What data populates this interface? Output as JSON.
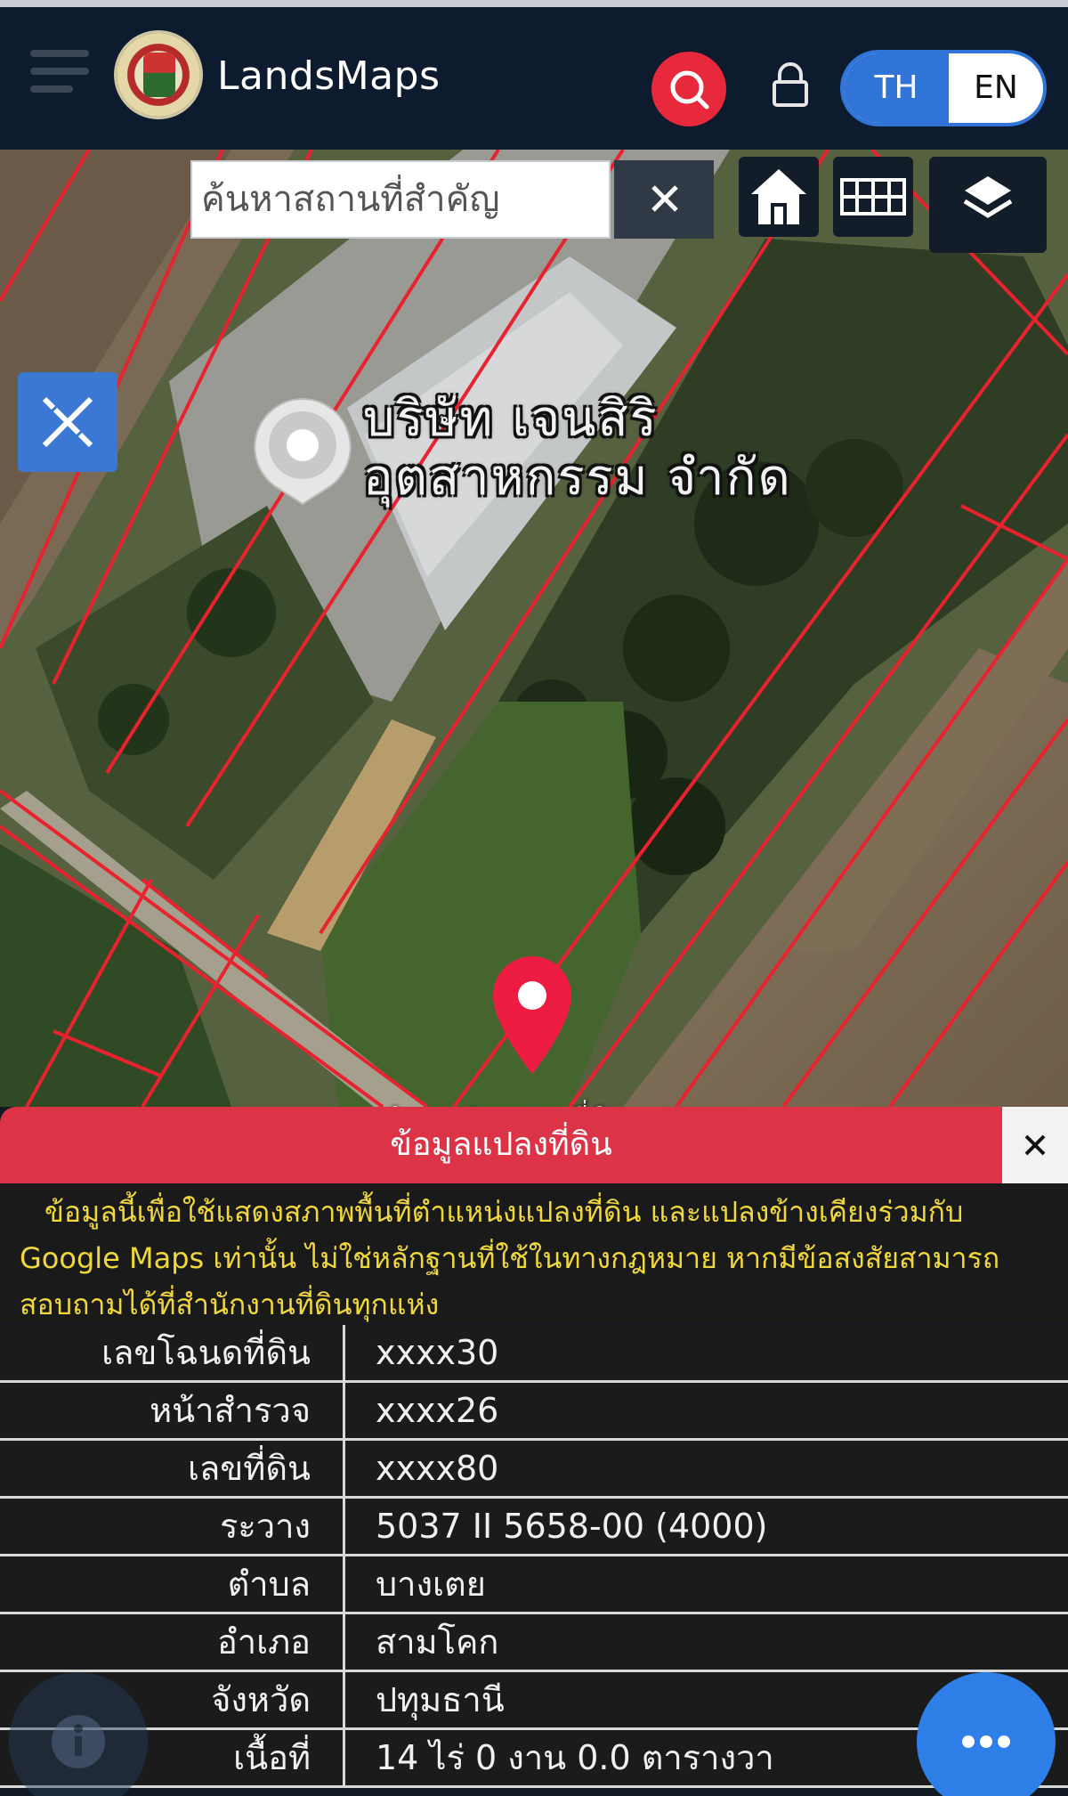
{
  "header": {
    "app_title": "LandsMaps",
    "menu_icon": "hamburger-menu-icon",
    "search_icon": "search-icon",
    "lock_icon": "lock-icon",
    "lang_th": "TH",
    "lang_en": "EN",
    "lang_selected": "TH",
    "colors": {
      "background": "#0d1b2e",
      "search_button": "#e8283b",
      "lang_active": "#2f74d6"
    }
  },
  "map": {
    "search_placeholder": "ค้นหาสถานที่สำคัญ",
    "clear_icon": "close-icon",
    "buttons": [
      "home-icon",
      "grid-icon",
      "layers-icon",
      "measure-tool-icon"
    ],
    "company_label_line1": "บริษัท เจนสิริ",
    "company_label_line2": "อุตสาหกรรม จำกัด",
    "parcel_label": "ตำแหน่งแปลงที่ดิน",
    "parcel_line_color": "#e8222e"
  },
  "panel": {
    "title": "ข้อมูลแปลงที่ดิน",
    "close_icon": "close-icon",
    "notice_line1": "ข้อมูลนี้เพื่อใช้แสดงสภาพพื้นที่ตำแหน่งแปลงที่ดิน และแปลงข้างเคียงร่วมกับ",
    "notice_line2": "Google Maps เท่านั้น ไม่ใช่หลักฐานที่ใช้ในทางกฎหมาย หากมีข้อสงสัยสามารถ",
    "notice_line3": "สอบถามได้ที่สำนักงานที่ดินทุกแห่ง",
    "rows": [
      {
        "label": "เลขโฉนดที่ดิน",
        "value": "xxxx30"
      },
      {
        "label": "หน้าสำรวจ",
        "value": "xxxx26"
      },
      {
        "label": "เลขที่ดิน",
        "value": "xxxx80"
      },
      {
        "label": "ระวาง",
        "value": "5037 II 5658-00 (4000)"
      },
      {
        "label": "ตำบล",
        "value": "บางเตย"
      },
      {
        "label": "อำเภอ",
        "value": "สามโคก"
      },
      {
        "label": "จังหวัด",
        "value": "ปทุมธานี"
      },
      {
        "label": "เนื้อที่",
        "value": "14 ไร่ 0 งาน 0.0 ตารางวา"
      }
    ]
  },
  "fabs": {
    "info_icon": "info-icon",
    "more_icon": "more-icon"
  }
}
